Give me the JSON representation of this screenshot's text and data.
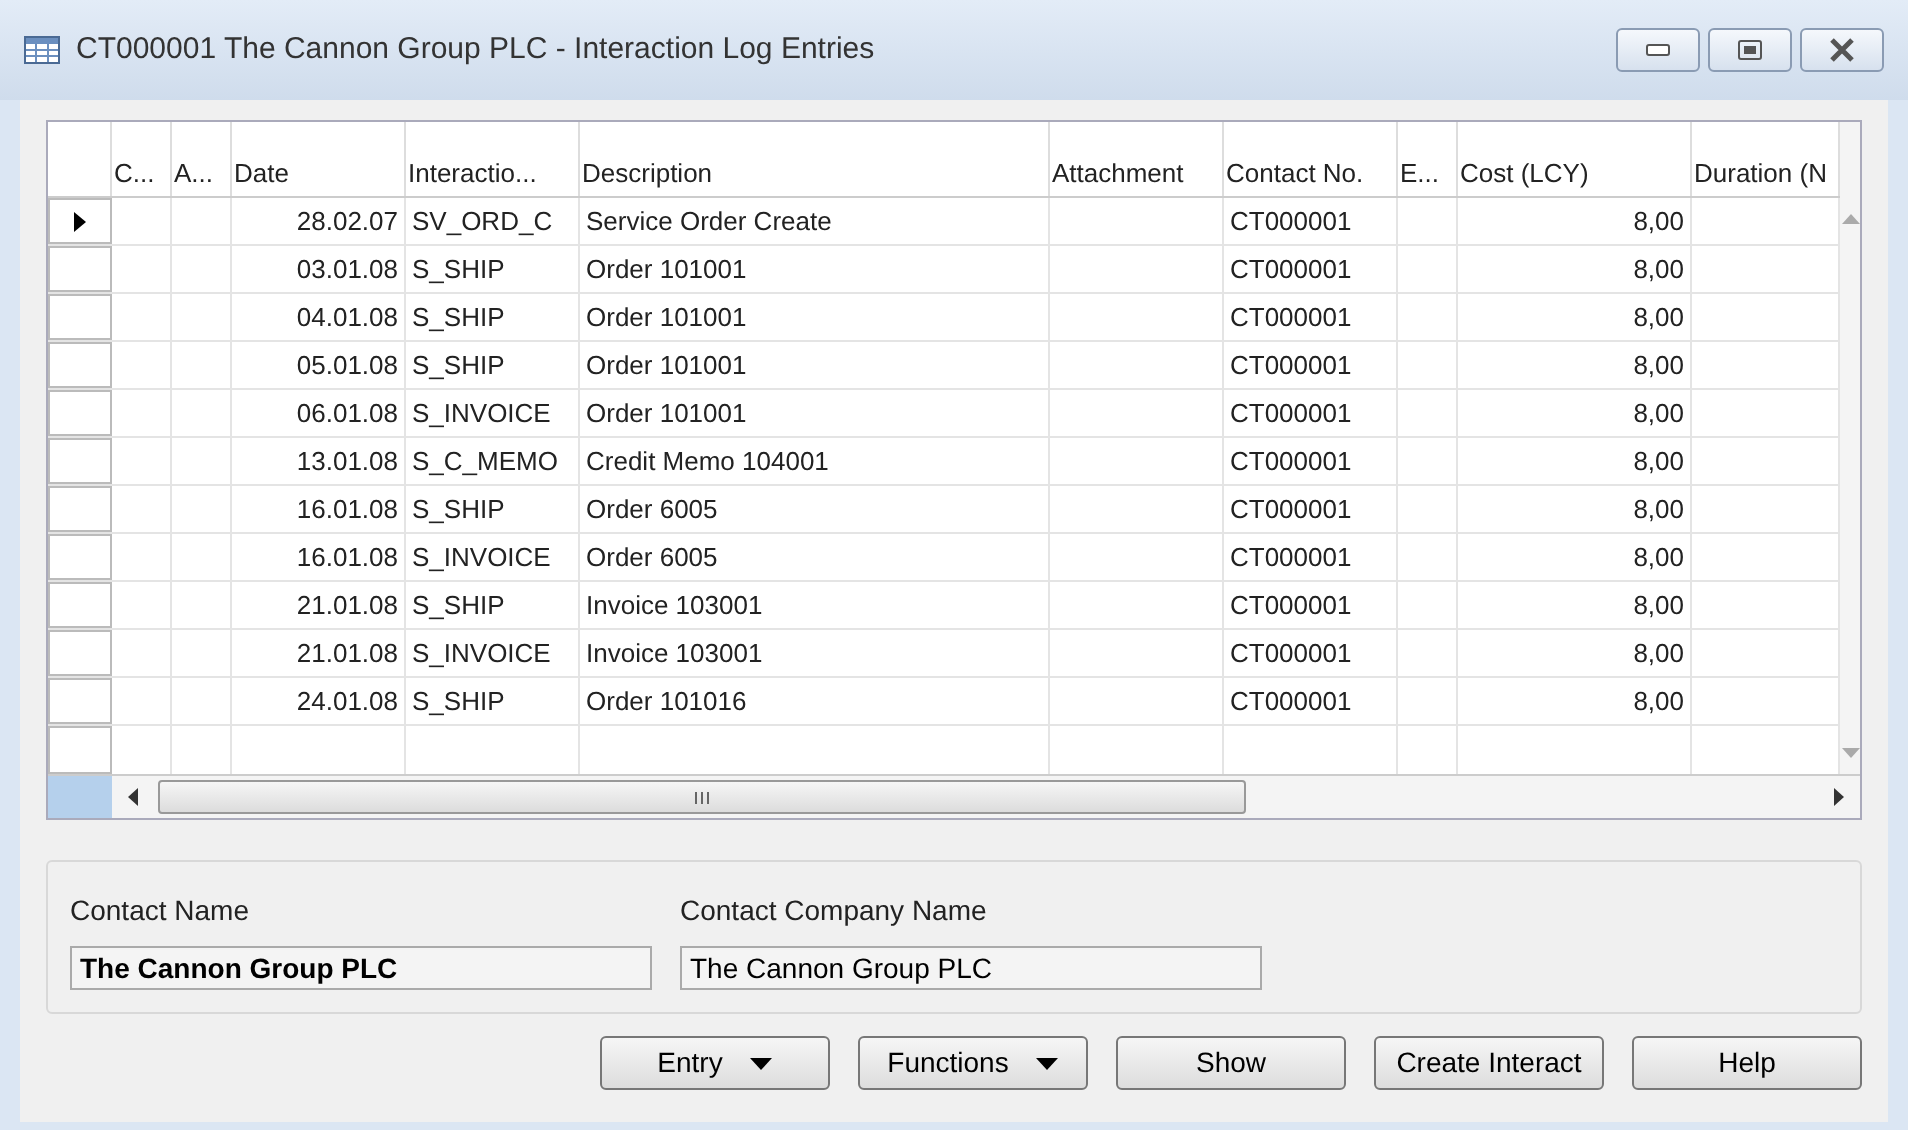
{
  "window": {
    "title": "CT000001 The Cannon Group PLC - Interaction Log Entries"
  },
  "table": {
    "columns": [
      "C...",
      "A...",
      "Date",
      "Interactio...",
      "Description",
      "Attachment",
      "Contact No.",
      "E...",
      "Cost (LCY)",
      "Duration (N"
    ],
    "rows": [
      {
        "selected": true,
        "date": "28.02.07",
        "interaction": "SV_ORD_C",
        "description": "Service Order Create",
        "contact_no": "CT000001",
        "cost": "8,00"
      },
      {
        "selected": false,
        "date": "03.01.08",
        "interaction": "S_SHIP",
        "description": "Order 101001",
        "contact_no": "CT000001",
        "cost": "8,00"
      },
      {
        "selected": false,
        "date": "04.01.08",
        "interaction": "S_SHIP",
        "description": "Order 101001",
        "contact_no": "CT000001",
        "cost": "8,00"
      },
      {
        "selected": false,
        "date": "05.01.08",
        "interaction": "S_SHIP",
        "description": "Order 101001",
        "contact_no": "CT000001",
        "cost": "8,00"
      },
      {
        "selected": false,
        "date": "06.01.08",
        "interaction": "S_INVOICE",
        "description": "Order 101001",
        "contact_no": "CT000001",
        "cost": "8,00"
      },
      {
        "selected": false,
        "date": "13.01.08",
        "interaction": "S_C_MEMO",
        "description": "Credit Memo 104001",
        "contact_no": "CT000001",
        "cost": "8,00"
      },
      {
        "selected": false,
        "date": "16.01.08",
        "interaction": "S_SHIP",
        "description": "Order 6005",
        "contact_no": "CT000001",
        "cost": "8,00"
      },
      {
        "selected": false,
        "date": "16.01.08",
        "interaction": "S_INVOICE",
        "description": "Order 6005",
        "contact_no": "CT000001",
        "cost": "8,00"
      },
      {
        "selected": false,
        "date": "21.01.08",
        "interaction": "S_SHIP",
        "description": "Invoice 103001",
        "contact_no": "CT000001",
        "cost": "8,00"
      },
      {
        "selected": false,
        "date": "21.01.08",
        "interaction": "S_INVOICE",
        "description": "Invoice 103001",
        "contact_no": "CT000001",
        "cost": "8,00"
      },
      {
        "selected": false,
        "date": "24.01.08",
        "interaction": "S_SHIP",
        "description": "Order 101016",
        "contact_no": "CT000001",
        "cost": "8,00"
      }
    ]
  },
  "fields": [
    {
      "label": "Contact Name",
      "value": "The Cannon Group PLC",
      "bold": true
    },
    {
      "label": "Contact Company Name",
      "value": "The Cannon Group PLC",
      "bold": false
    }
  ],
  "buttons": [
    {
      "label": "Entry",
      "dropdown": true
    },
    {
      "label": "Functions",
      "dropdown": true
    },
    {
      "label": "Show",
      "dropdown": false
    },
    {
      "label": "Create Interact",
      "dropdown": false
    },
    {
      "label": "Help",
      "dropdown": false
    }
  ]
}
